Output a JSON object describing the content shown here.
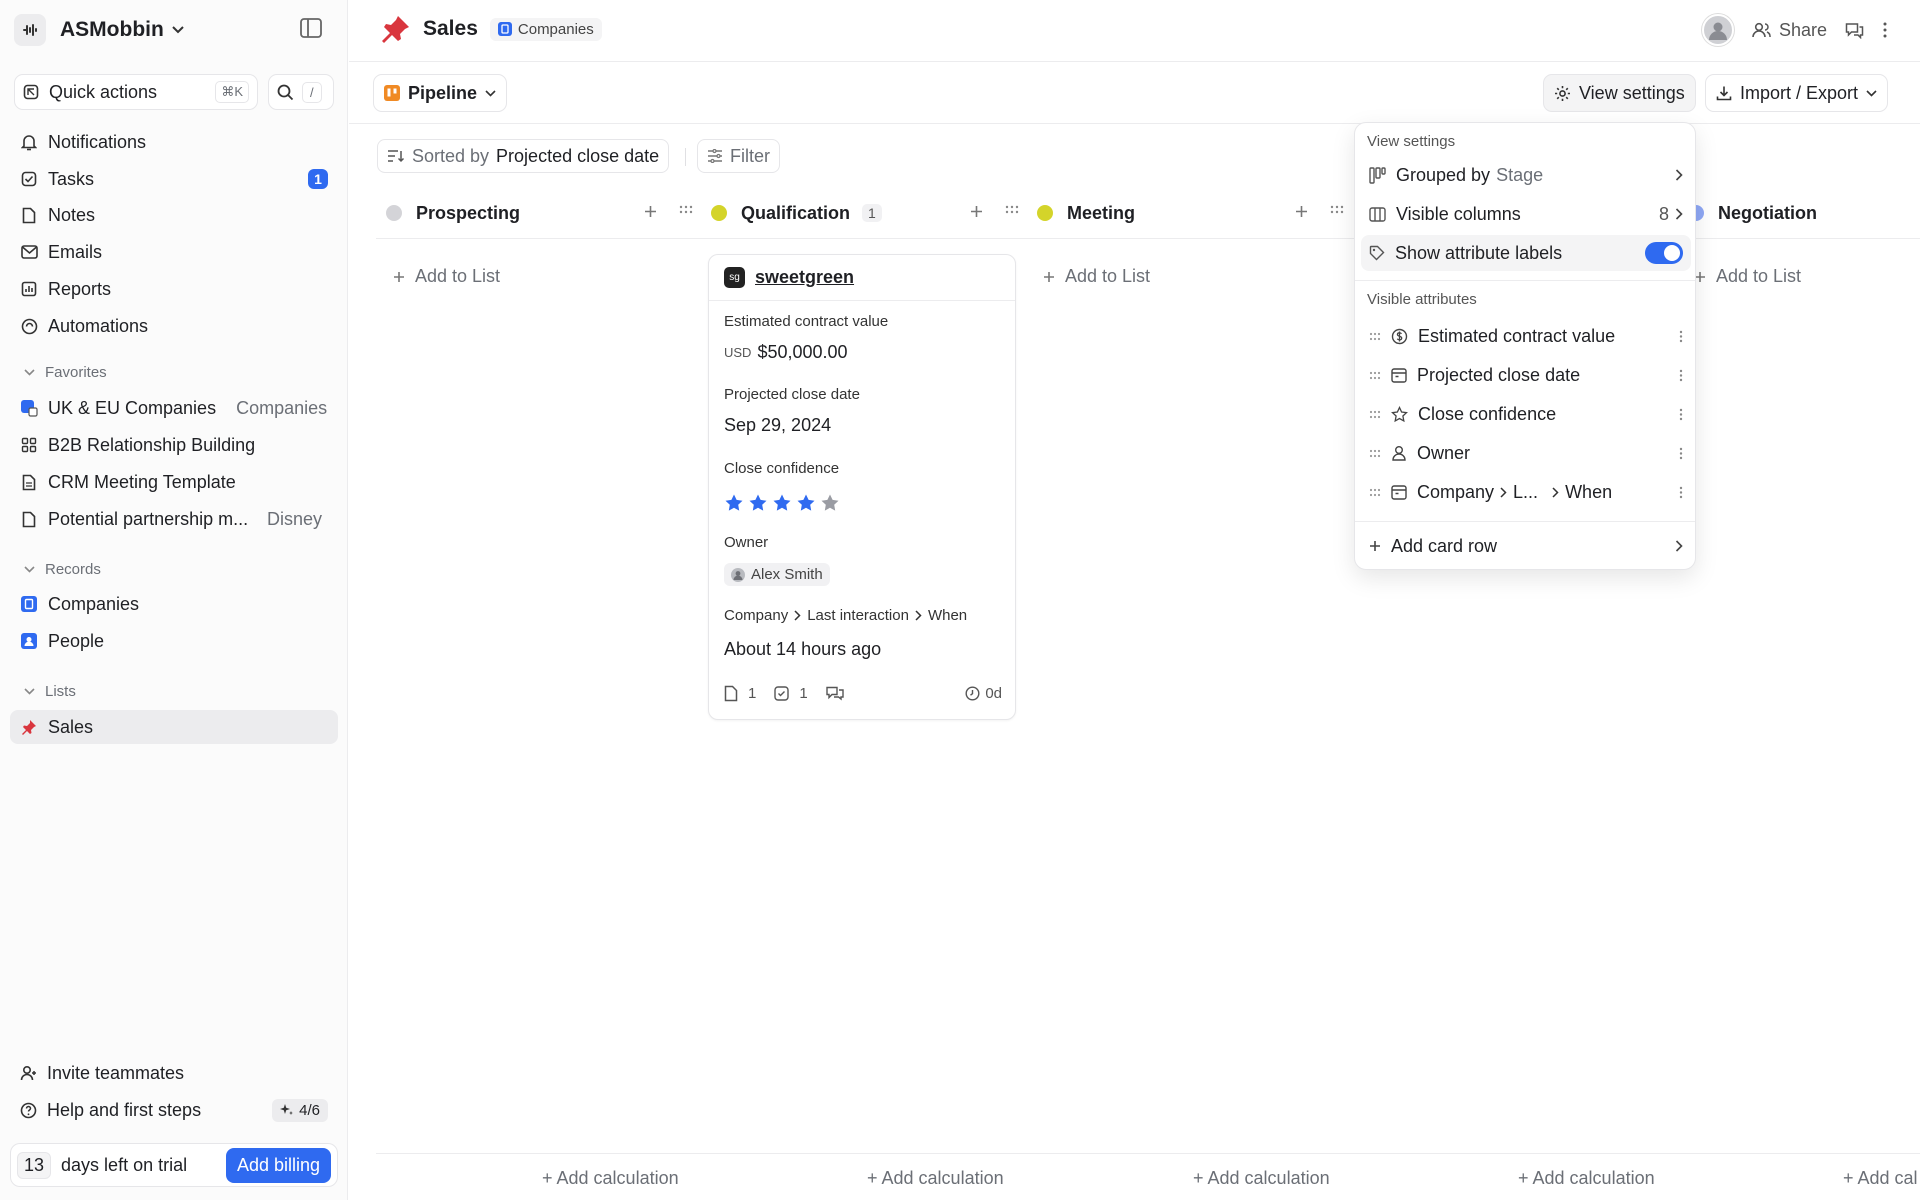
{
  "workspace": {
    "name": "ASMobbin"
  },
  "sidebar": {
    "quick_actions": {
      "label": "Quick actions",
      "shortcut": "⌘K"
    },
    "search": {
      "shortcut": "/"
    },
    "nav": [
      {
        "label": "Notifications"
      },
      {
        "label": "Tasks",
        "badge": "1"
      },
      {
        "label": "Notes"
      },
      {
        "label": "Emails"
      },
      {
        "label": "Reports"
      },
      {
        "label": "Automations"
      }
    ],
    "favorites": {
      "title": "Favorites",
      "items": [
        {
          "label": "UK & EU Companies",
          "tail": "Companies"
        },
        {
          "label": "B2B Relationship Building"
        },
        {
          "label": "CRM Meeting Template"
        },
        {
          "label": "Potential partnership m...",
          "tail": "Disney"
        }
      ]
    },
    "records": {
      "title": "Records",
      "items": [
        {
          "label": "Companies"
        },
        {
          "label": "People"
        }
      ]
    },
    "lists": {
      "title": "Lists",
      "items": [
        {
          "label": "Sales"
        }
      ]
    },
    "footer": {
      "invite": "Invite teammates",
      "help": "Help and first steps",
      "help_progress": "4/6",
      "trial_days": "13",
      "trial_text": "days left on trial",
      "billing_button": "Add billing"
    }
  },
  "header": {
    "title": "Sales",
    "object_chip": "Companies",
    "share": "Share"
  },
  "view": {
    "name": "Pipeline",
    "view_settings": "View settings",
    "import_export": "Import / Export"
  },
  "sort": {
    "prefix": "Sorted by",
    "field": "Projected close date",
    "filter": "Filter"
  },
  "columns": [
    {
      "name": "Prospecting",
      "color": "#d4d4d8",
      "count": ""
    },
    {
      "name": "Qualification",
      "color": "#d4d42a",
      "count": "1"
    },
    {
      "name": "Meeting",
      "color": "#d4d42a",
      "count": ""
    },
    {
      "name": "Negotiation",
      "color": "#8fa8f5",
      "count": ""
    }
  ],
  "add_to_list": "Add to List",
  "card": {
    "company": "sweetgreen",
    "logo_text": "sg",
    "fields": {
      "ecv_label": "Estimated contract value",
      "ecv_currency": "USD",
      "ecv_value": "$50,000.00",
      "pcd_label": "Projected close date",
      "pcd_value": "Sep 29, 2024",
      "cc_label": "Close confidence",
      "cc_rating": 4,
      "cc_max": 5,
      "owner_label": "Owner",
      "owner_value": "Alex Smith",
      "li_part1": "Company",
      "li_part2": "Last interaction",
      "li_part3": "When",
      "li_value": "About 14 hours ago"
    },
    "footer": {
      "notes": "1",
      "tasks": "1",
      "age": "0d"
    }
  },
  "view_settings_menu": {
    "title": "View settings",
    "grouped_prefix": "Grouped by",
    "grouped_value": "Stage",
    "visible_columns": "Visible columns",
    "visible_columns_count": "8",
    "show_labels": "Show attribute labels",
    "show_labels_on": true,
    "attributes_title": "Visible attributes",
    "attributes": [
      {
        "label": "Estimated contract value",
        "icon": "currency-icon"
      },
      {
        "label": "Projected close date",
        "icon": "calendar-icon"
      },
      {
        "label": "Close confidence",
        "icon": "star-icon"
      },
      {
        "label": "Owner",
        "icon": "person-icon"
      }
    ],
    "path_attr": {
      "part1": "Company",
      "part2": "L...",
      "part3": "When"
    },
    "add_card_row": "Add card row"
  },
  "footer": {
    "add_calculation": "+ Add calculation",
    "add_calculation_truncated": "+ Add cal"
  },
  "colors": {
    "accent": "#2f6af0",
    "star_on": "#2f6af0",
    "star_off": "#9a9ca3"
  }
}
